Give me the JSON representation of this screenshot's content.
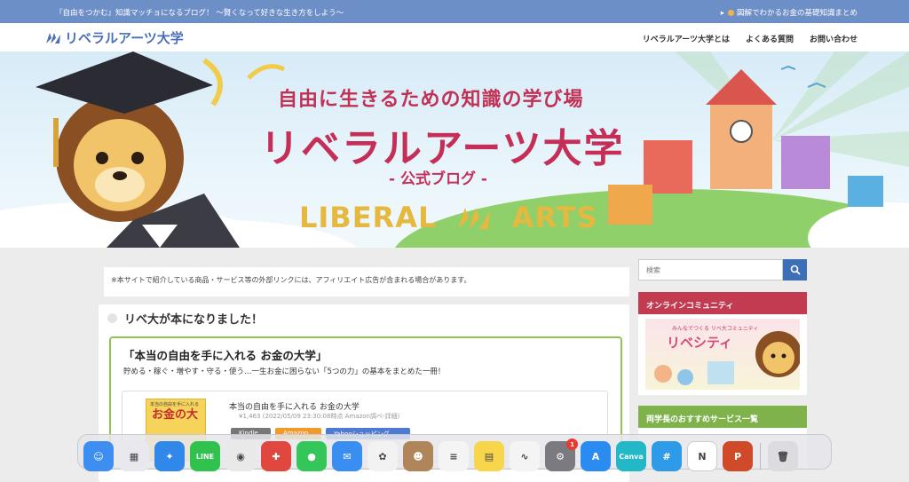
{
  "topbar": {
    "tagline": "『自由をつかむ』知識マッチョになるブログ！ 〜賢くなって好きな生き方をしよう〜",
    "quick_link": "図解でわかるお金の基礎知識まとめ"
  },
  "header": {
    "logo_text": "リベラルアーツ大学",
    "nav": [
      "リベラルアーツ大学とは",
      "よくある質問",
      "お問い合わせ"
    ]
  },
  "hero": {
    "subtitle": "自由に生きるための知識の学び場",
    "title": "リベラルアーツ大学",
    "blog_label": "- 公式ブログ -",
    "brand_left": "LIBERAL",
    "brand_right": "ARTS"
  },
  "notice": "※本サイトで紹介している商品・サービス等の外部リンクには、アフィリエイト広告が含まれる場合があります。",
  "post": {
    "heading": "リベ大が本になりました！",
    "box_title": "「本当の自由を手に入れる お金の大学」",
    "box_desc": "貯める・稼ぐ・増やす・守る・使う…一生お金に困らない「5つの力」の基本をまとめた一冊！",
    "book": {
      "cover_small": "本当の自由を手に入れる",
      "cover_title": "お金の大",
      "title": "本当の自由を手に入れる お金の大学",
      "price": "¥1,463 (2022/05/09 23:30:08時点 Amazon調べ-詳細)",
      "buttons": [
        "Kindle",
        "Amazon",
        "Yahooショッピング"
      ]
    }
  },
  "sidebar": {
    "search_placeholder": "検索",
    "community_title": "オンラインコミュニティ",
    "community_banner_small": "みんなでつくる リベ大コミュニティ",
    "community_banner_big": "リベシティ",
    "services_title": "両学長のおすすめサービス一覧"
  },
  "dock": {
    "apps": [
      {
        "name": "Finder",
        "icon": "finder-icon",
        "color": "#3d8ef0",
        "glyph": "☺"
      },
      {
        "name": "Launchpad",
        "icon": "launchpad-icon",
        "color": "#e8e8ee",
        "glyph": "▦"
      },
      {
        "name": "Safari",
        "icon": "safari-icon",
        "color": "#2f88ea",
        "glyph": "✦"
      },
      {
        "name": "LINE",
        "icon": "line-icon",
        "color": "#2fc24c",
        "glyph": "LINE"
      },
      {
        "name": "Chrome",
        "icon": "chrome-icon",
        "color": "#e9e9e9",
        "glyph": "◉"
      },
      {
        "name": "Slack-like",
        "icon": "puzzle-icon",
        "color": "#e0483f",
        "glyph": "✚"
      },
      {
        "name": "Messages",
        "icon": "messages-icon",
        "color": "#35c65a",
        "glyph": "●"
      },
      {
        "name": "Mail",
        "icon": "mail-icon",
        "color": "#3a8ef2",
        "glyph": "✉"
      },
      {
        "name": "Photos",
        "icon": "photos-icon",
        "color": "#f2f2f2",
        "glyph": "✿"
      },
      {
        "name": "Contacts",
        "icon": "contacts-icon",
        "color": "#b0855a",
        "glyph": "☻"
      },
      {
        "name": "Reminders",
        "icon": "reminders-icon",
        "color": "#f4f4f4",
        "glyph": "≡"
      },
      {
        "name": "Notes",
        "icon": "notes-icon",
        "color": "#f8d64b",
        "glyph": "▤"
      },
      {
        "name": "Freeform",
        "icon": "freeform-icon",
        "color": "#f4f4f4",
        "glyph": "∿"
      },
      {
        "name": "System Settings",
        "icon": "settings-icon",
        "color": "#7a7a80",
        "glyph": "⚙",
        "badge": "1"
      },
      {
        "name": "App Store",
        "icon": "appstore-icon",
        "color": "#2a8cf0",
        "glyph": "A"
      },
      {
        "name": "Canva",
        "icon": "canva-icon",
        "color": "#22b8c8",
        "glyph": "Canva"
      },
      {
        "name": "Hashtag",
        "icon": "hashtag-icon",
        "color": "#2e9be8",
        "glyph": "#"
      },
      {
        "name": "Notion",
        "icon": "notion-icon",
        "color": "#ffffff",
        "glyph": "N"
      },
      {
        "name": "PowerPoint",
        "icon": "powerpoint-icon",
        "color": "#d04a2a",
        "glyph": "P"
      },
      {
        "name": "Trash",
        "icon": "trash-icon",
        "color": "#dcdce0",
        "glyph": "🗑"
      }
    ]
  }
}
